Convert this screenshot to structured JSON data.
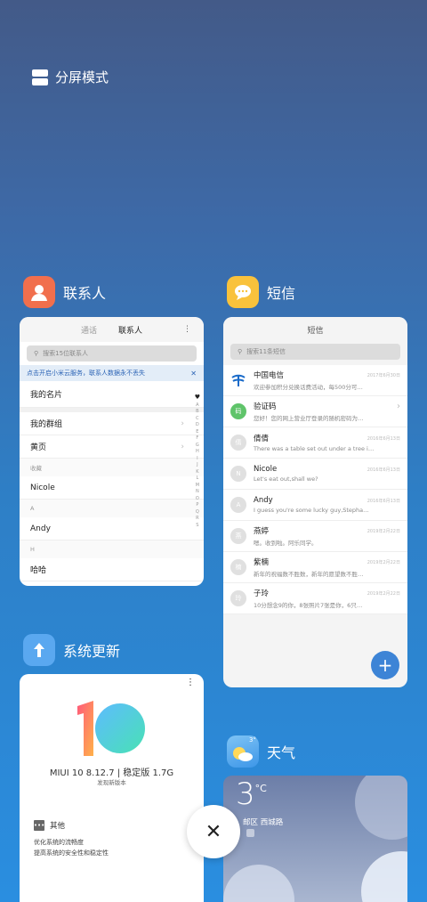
{
  "split_screen": {
    "label": "分屏模式"
  },
  "apps": {
    "contacts": {
      "name": "联系人",
      "tabs": [
        "通话",
        "联系人"
      ],
      "search_placeholder": "搜索15位联系人",
      "notice": "点击开启小米云服务，联系人数据永不丢失",
      "rows": {
        "my_card": "我的名片",
        "my_groups": "我的群组",
        "yellow_pages": "黄页",
        "section_fav": "收藏",
        "nicole": "Nicole",
        "section_a": "A",
        "andy": "Andy",
        "section_h": "H",
        "haha": "哈哈"
      },
      "alpha": [
        "♥",
        "A",
        "B",
        "C",
        "D",
        "E",
        "F",
        "G",
        "H",
        "I",
        "J",
        "K",
        "L",
        "M",
        "N",
        "O",
        "P",
        "Q",
        "R",
        "S"
      ]
    },
    "messages": {
      "name": "短信",
      "title": "短信",
      "search_placeholder": "搜索11条短信",
      "items": [
        {
          "avatar": "",
          "name": "中国电信",
          "date": "2017年6月30日",
          "preview": "欢迎参加积分兑换话费活动，每500分可…"
        },
        {
          "avatar": "码",
          "name": "验证码",
          "date": "",
          "preview": "您好！您的网上营业厅登录的随机密码为…"
        },
        {
          "avatar": "倩",
          "name": "倩倩",
          "date": "2016年6月13日",
          "preview": "There was a table set out under a tree i…"
        },
        {
          "avatar": "N",
          "name": "Nicole",
          "date": "2016年6月13日",
          "preview": "Let's eat out,shall we?"
        },
        {
          "avatar": "A",
          "name": "Andy",
          "date": "2016年6月13日",
          "preview": "I guess you're some lucky guy,Stepha…"
        },
        {
          "avatar": "燕",
          "name": "燕婷",
          "date": "2019年2月22日",
          "preview": "嗯。收到啦。阿乐同学。"
        },
        {
          "avatar": "楠",
          "name": "紫楠",
          "date": "2019年2月22日",
          "preview": "新年的祝福数不胜数，新年的愿望数不胜…"
        },
        {
          "avatar": "玲",
          "name": "子玲",
          "date": "2019年2月22日",
          "preview": "10分想念9的你，8张照片7张是你，6只…"
        }
      ],
      "fab": "+"
    },
    "updater": {
      "name": "系统更新",
      "version": "MIUI 10 8.12.7 | 稳定版 1.7G",
      "subtitle": "发现新版本",
      "section_title": "其他",
      "line1": "优化系统的流畅度",
      "line2": "提高系统的安全性和稳定性",
      "more": "⋮"
    },
    "weather": {
      "name": "天气",
      "icon_temp": "3°",
      "temp": "3",
      "unit": "°C",
      "location": "邮区  西城路"
    }
  },
  "close_label": "✕",
  "colors": {
    "accent": "#3d84d6",
    "contacts_icon": "#f16f4d",
    "messages_icon": "#f9c23c",
    "updater_icon": "#5aa8f0"
  }
}
